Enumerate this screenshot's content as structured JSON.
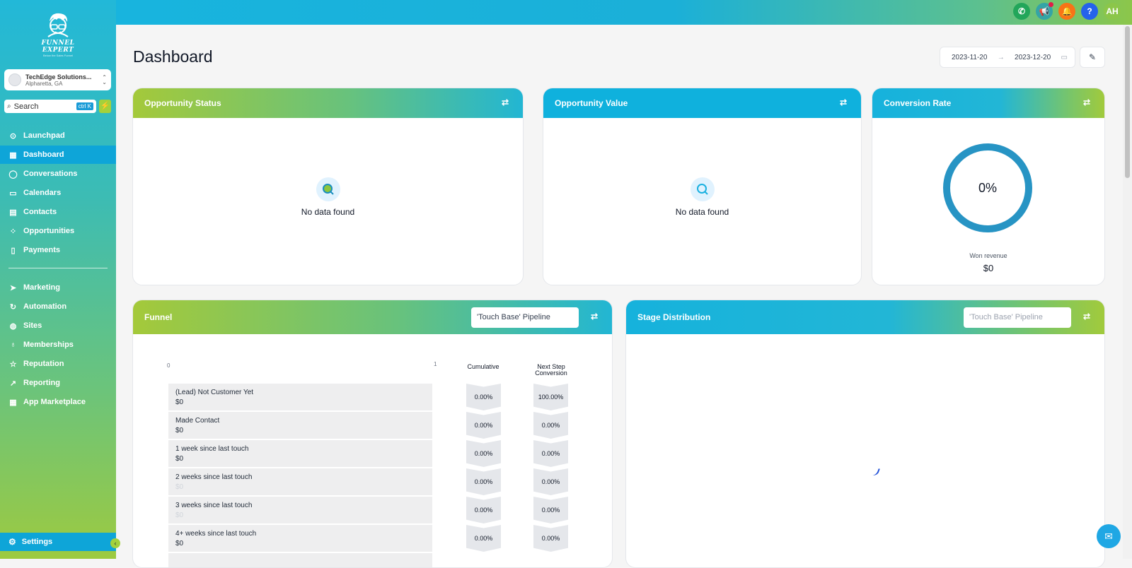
{
  "brand": {
    "name": "FUNNEL EXPERT",
    "tagline": "Below the Sales Funnel"
  },
  "account": {
    "name": "TechEdge Solutions...",
    "location": "Alpharetta, GA"
  },
  "search": {
    "placeholder": "Search",
    "shortcut": "ctrl K"
  },
  "nav": {
    "launchpad": "Launchpad",
    "dashboard": "Dashboard",
    "conversations": "Conversations",
    "calendars": "Calendars",
    "contacts": "Contacts",
    "opportunities": "Opportunities",
    "payments": "Payments",
    "marketing": "Marketing",
    "automation": "Automation",
    "sites": "Sites",
    "memberships": "Memberships",
    "reputation": "Reputation",
    "reporting": "Reporting",
    "app_marketplace": "App Marketplace",
    "settings": "Settings"
  },
  "topbar": {
    "avatar_initials": "AH",
    "help_icon": "?",
    "colors": {
      "phone": "#22a65a",
      "megaphone": "#35a4a6",
      "bell": "#f97316",
      "help": "#2563eb",
      "avatar": "#8cc64a"
    }
  },
  "page": {
    "title": "Dashboard",
    "date_start": "2023-11-20",
    "date_end": "2023-12-20"
  },
  "cards": {
    "opportunity_status": {
      "title": "Opportunity Status",
      "empty_text": "No data found"
    },
    "opportunity_value": {
      "title": "Opportunity Value",
      "empty_text": "No data found"
    },
    "conversion_rate": {
      "title": "Conversion Rate",
      "percent": "0%",
      "won_revenue_label": "Won revenue",
      "won_revenue_value": "$0"
    }
  },
  "funnel": {
    "title": "Funnel",
    "pipeline": "'Touch Base' Pipeline",
    "axis_min": "0",
    "axis_max": "1",
    "col_cumulative": "Cumulative",
    "col_next_step": "Next Step Conversion",
    "rows": [
      {
        "stage": "(Lead) Not Customer Yet",
        "value": "$0",
        "cumulative": "0.00%",
        "next": "100.00%"
      },
      {
        "stage": "Made Contact",
        "value": "$0",
        "cumulative": "0.00%",
        "next": "0.00%"
      },
      {
        "stage": "1 week since last touch",
        "value": "$0",
        "cumulative": "0.00%",
        "next": "0.00%"
      },
      {
        "stage": "2 weeks since last touch",
        "value": "$0",
        "cumulative": "0.00%",
        "next": "0.00%"
      },
      {
        "stage": "3 weeks since last touch",
        "value": "$0",
        "cumulative": "0.00%",
        "next": "0.00%"
      },
      {
        "stage": "4+ weeks since last touch",
        "value": "$0",
        "cumulative": "0.00%",
        "next": "0.00%"
      }
    ]
  },
  "stage_distribution": {
    "title": "Stage Distribution",
    "pipeline": "'Touch Base' Pipeline"
  }
}
